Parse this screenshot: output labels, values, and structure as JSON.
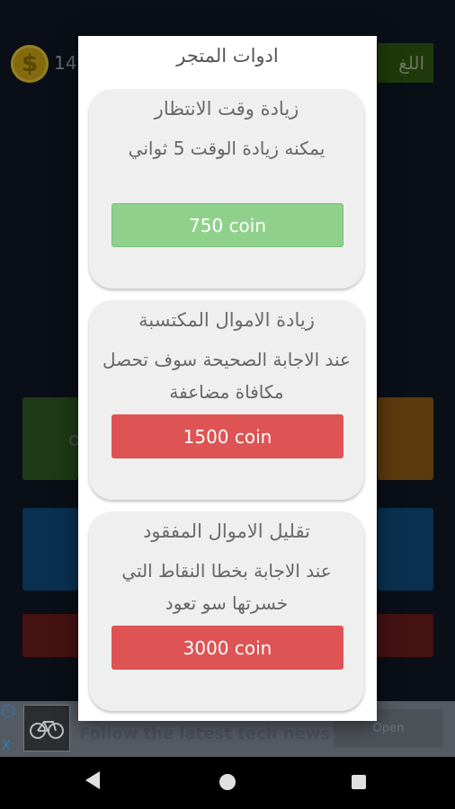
{
  "background": {
    "coin_icon": "$",
    "coin_count": "14",
    "language_button": "اللغ"
  },
  "dialog": {
    "title": "ادوات المتجر",
    "items": [
      {
        "title": "زيادة وقت الانتظار",
        "description": "يمكنه زيادة الوقت 5 ثواني",
        "price": "750 coin",
        "button_color": "#8fd18b"
      },
      {
        "title": "زيادة الاموال المكتسبة",
        "description": "عند الاجابة الصحيحة سوف تحصل مكافاة مضاعفة",
        "price": "1500 coin",
        "button_color": "#de5353"
      },
      {
        "title": "تقليل الاموال المفقود",
        "description": "عند الاجابة بخطا النقاط التي خسرتها سو تعود",
        "price": "3000 coin",
        "button_color": "#de5353"
      }
    ]
  },
  "ad": {
    "info_icon": "i",
    "close_icon": "X",
    "text": "Follow the latest tech news",
    "button": "Open"
  },
  "navbar": {
    "icons": [
      "back-icon",
      "home-icon",
      "recent-apps-icon"
    ]
  },
  "colors": {
    "card_background": "#efefef",
    "buy_enabled": "#8fd18b",
    "buy_disabled": "#de5353"
  }
}
